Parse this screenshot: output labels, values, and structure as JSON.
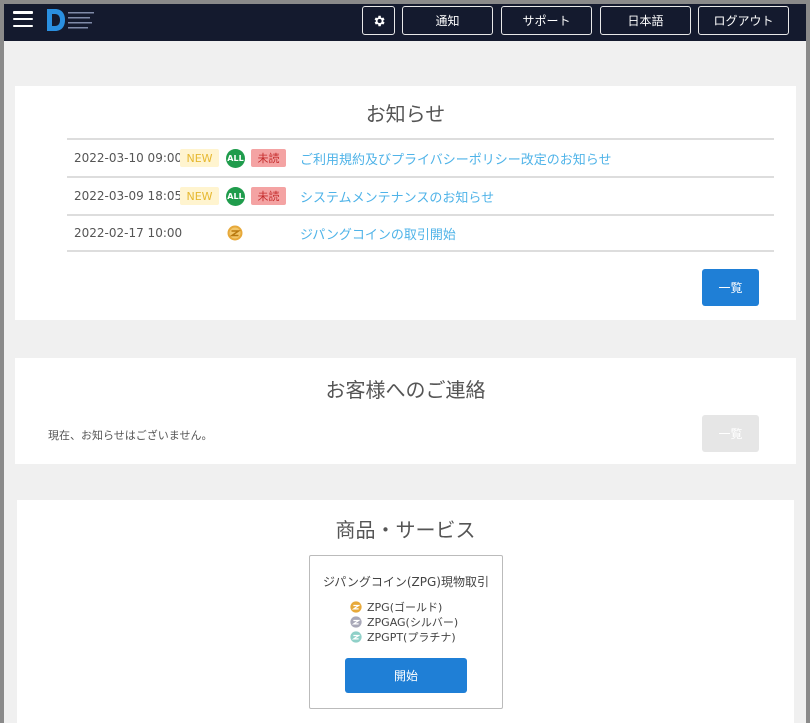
{
  "header": {
    "gear_label": "settings",
    "notice_label": "通知",
    "support_label": "サポート",
    "lang_label": "日本語",
    "logout_label": "ログアウト"
  },
  "notices": {
    "title": "お知らせ",
    "items": [
      {
        "date": "2022-03-10 09:00",
        "new": "NEW",
        "all": "ALL",
        "unread": "未読",
        "title": "ご利用規約及びプライバシーポリシー改定のお知らせ"
      },
      {
        "date": "2022-03-09 18:05",
        "new": "NEW",
        "all": "ALL",
        "unread": "未読",
        "title": "システムメンテナンスのお知らせ"
      },
      {
        "date": "2022-02-17 10:00",
        "icon": "zipang-coin-icon",
        "title": "ジパングコインの取引開始"
      }
    ],
    "list_button": "一覧"
  },
  "contact": {
    "title": "お客様へのご連絡",
    "empty_text": "現在、お知らせはございません。",
    "list_button": "一覧"
  },
  "products": {
    "title": "商品・サービス",
    "card_title": "ジパングコイン(ZPG)現物取引",
    "items": [
      {
        "label": "ZPG(ゴールド)",
        "icon": "zpg-gold-icon"
      },
      {
        "label": "ZPGAG(シルバー)",
        "icon": "zpgag-silver-icon"
      },
      {
        "label": "ZPGPT(プラチナ)",
        "icon": "zpgpt-platinum-icon"
      }
    ],
    "start_button": "開始"
  },
  "colors": {
    "header_bg": "#141a2e",
    "accent_blue": "#1f7fd6",
    "link": "#4fb3e8",
    "badge_new_bg": "#fff4cf",
    "badge_all": "#1f9c4c",
    "badge_unread_bg": "#f4a3a3"
  }
}
